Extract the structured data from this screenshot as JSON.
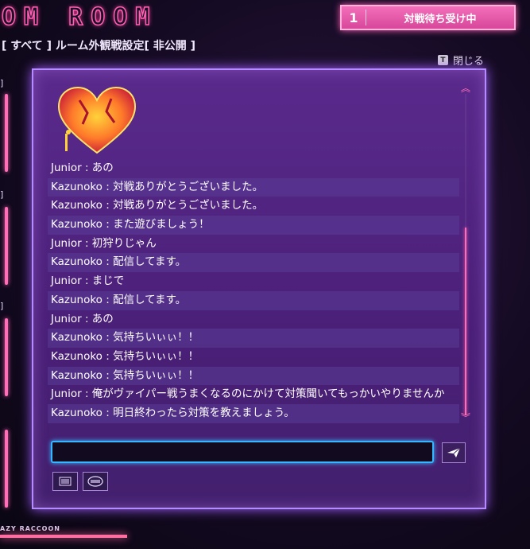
{
  "header": {
    "room_title": "OM ROOM",
    "status_number": "1",
    "status_label": "対戦待ち受け中",
    "filter_text": "[ すべて ] ルーム外観戦設定[ 非公開 ]",
    "close_key": "T",
    "close_label": "閉じる"
  },
  "bottom_tag": "AZY RACCOON",
  "chat": {
    "messages": [
      {
        "text": "Junior : あの"
      },
      {
        "text": "Kazunoko : 対戦ありがとうございました。"
      },
      {
        "text": "Kazunoko : 対戦ありがとうございました。"
      },
      {
        "text": "Kazunoko : また遊びましょう！"
      },
      {
        "text": "Junior : 初狩りじゃん"
      },
      {
        "text": "Kazunoko : 配信してます。"
      },
      {
        "text": "Junior : まじで"
      },
      {
        "text": "Kazunoko : 配信してます。"
      },
      {
        "text": "Junior : あの"
      },
      {
        "text": "Kazunoko : 気持ちいぃぃ！！"
      },
      {
        "text": "Kazunoko : 気持ちいぃぃ！！"
      },
      {
        "text": "Kazunoko : 気持ちいぃぃ！！"
      },
      {
        "text": "Junior : 俺がヴァイパー戦うまくなるのにかけて対策聞いてもっかいやりませんか"
      },
      {
        "text": "Kazunoko : 明日終わったら対策を教えましょう。"
      }
    ],
    "input_value": "",
    "icons": {
      "avatar": "heart-avatar-icon",
      "send": "paper-plane-icon",
      "log": "list-icon",
      "stamp": "stamp-icon",
      "scroll_up": "chevron-up-icon",
      "scroll_down": "chevron-down-icon"
    }
  },
  "colors": {
    "accent_pink": "#ff6fb8",
    "panel_purple": "#4a1f78",
    "input_border": "#35b7ff"
  }
}
